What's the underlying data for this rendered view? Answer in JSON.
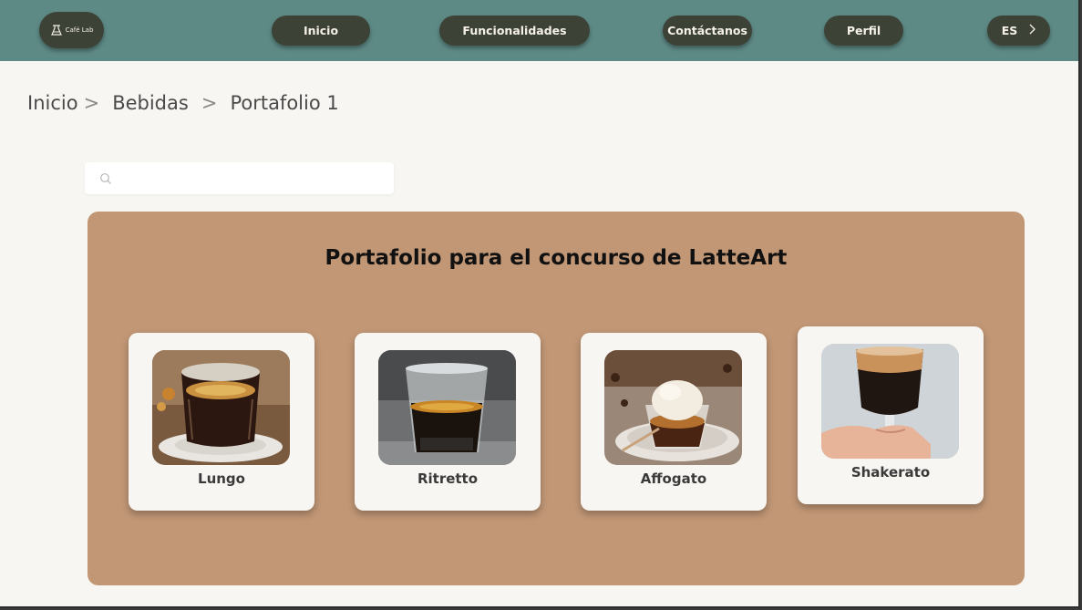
{
  "header": {
    "logo_text": "Café Lab",
    "nav": [
      {
        "label": "Inicio"
      },
      {
        "label": "Funcionalidades"
      },
      {
        "label": "Contáctanos"
      },
      {
        "label": "Perfil"
      }
    ],
    "language": {
      "label": "ES"
    }
  },
  "breadcrumb": {
    "items": [
      "Inicio",
      "Bebidas"
    ],
    "current": "Portafolio 1",
    "separator": ">"
  },
  "search": {
    "value": "",
    "placeholder": ""
  },
  "portfolio": {
    "title": "Portafolio para el concurso de LatteArt",
    "cards": [
      {
        "label": "Lungo",
        "image": "lungo-coffee-photo"
      },
      {
        "label": "Ritretto",
        "image": "ristretto-coffee-photo"
      },
      {
        "label": "Affogato",
        "image": "affogato-photo"
      },
      {
        "label": "Shakerato",
        "image": "shakerato-photo"
      }
    ]
  },
  "colors": {
    "navbar": "#5e8a86",
    "nav_button": "#3d4236",
    "page_background": "#f8f6f2",
    "panel": "#c19776",
    "card": "#f8f6f2"
  }
}
